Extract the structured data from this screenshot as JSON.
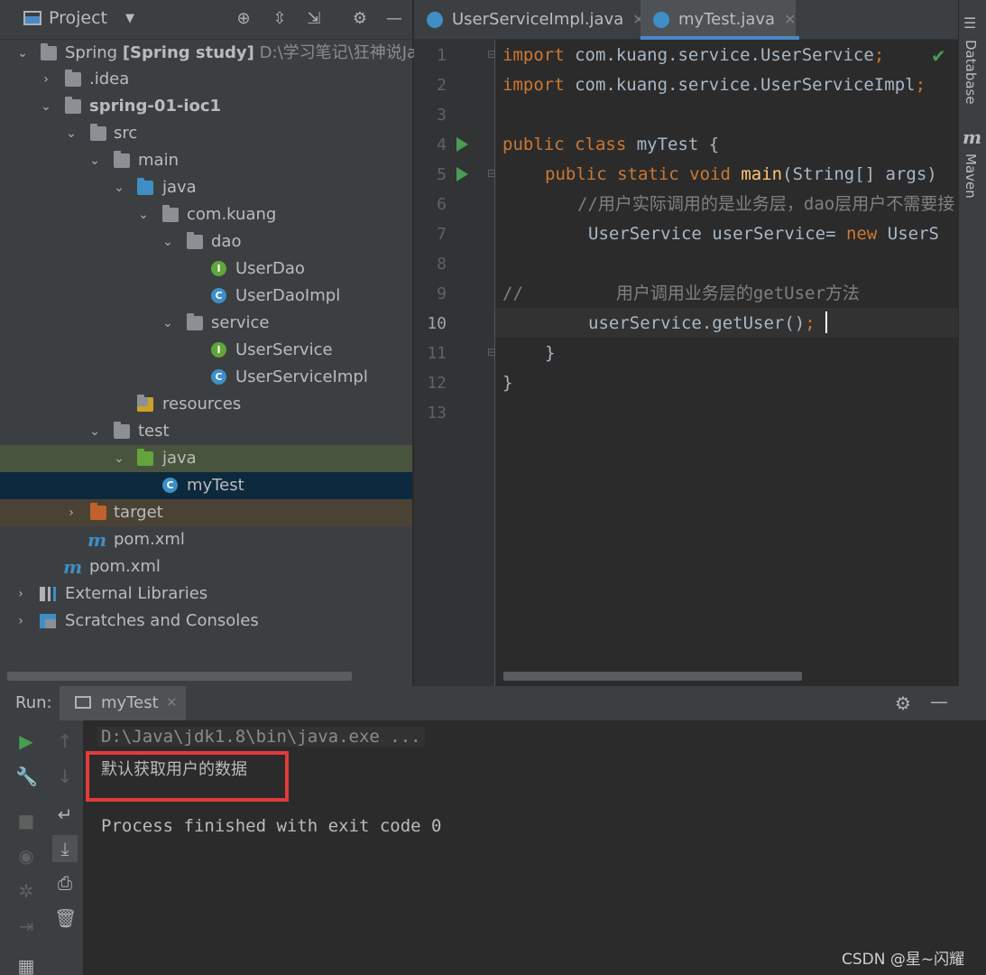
{
  "project": {
    "title": "Project",
    "tree": [
      {
        "label": "Spring",
        "bold_part": "[Spring study]",
        "path": "D:\\学习笔记\\狂神说Jav"
      },
      {
        "label": ".idea"
      },
      {
        "label": "spring-01-ioc1"
      },
      {
        "label": "src"
      },
      {
        "label": "main"
      },
      {
        "label": "java"
      },
      {
        "label": "com.kuang"
      },
      {
        "label": "dao"
      },
      {
        "label": "UserDao"
      },
      {
        "label": "UserDaoImpl"
      },
      {
        "label": "service"
      },
      {
        "label": "UserService"
      },
      {
        "label": "UserServiceImpl"
      },
      {
        "label": "resources"
      },
      {
        "label": "test"
      },
      {
        "label": "java"
      },
      {
        "label": "myTest"
      },
      {
        "label": "target"
      },
      {
        "label": "pom.xml"
      },
      {
        "label": "pom.xml"
      },
      {
        "label": "External Libraries"
      },
      {
        "label": "Scratches and Consoles"
      }
    ]
  },
  "editor": {
    "tabs": [
      {
        "label": "UserServiceImpl.java"
      },
      {
        "label": "myTest.java"
      }
    ],
    "line_numbers": [
      "1",
      "2",
      "3",
      "4",
      "5",
      "6",
      "7",
      "8",
      "9",
      "10",
      "11",
      "12",
      "13"
    ],
    "lines": {
      "l1_kw": "import",
      "l1_rest": " com.kuang.service.UserService",
      "l1_semi": ";",
      "l2_kw": "import",
      "l2_rest": " com.kuang.service.UserServiceImpl",
      "l2_semi": ";",
      "l4_kw": "public class",
      "l4_rest": " myTest {",
      "l5_kw": "public static void",
      "l5_fn": "main",
      "l5_rest": "(String[] args)",
      "l6": "//用户实际调用的是业务层，dao层用户不需要接",
      "l7_a": "UserService userService= ",
      "l7_kw": "new",
      "l7_b": " UserS",
      "l9": "//         用户调用业务层的getUser方法",
      "l10": "userService.getUser()",
      "l10_semi": ";",
      "l11": "}",
      "l12": "}"
    }
  },
  "right_strip": {
    "database": "Database",
    "maven_icon": "m",
    "maven": "Maven"
  },
  "run": {
    "label": "Run:",
    "tab": "myTest",
    "console": {
      "cmd": "D:\\Java\\jdk1.8\\bin\\java.exe ...",
      "output": "默认获取用户的数据",
      "exit": "Process finished with exit code 0"
    }
  },
  "watermark": "CSDN @星~闪耀"
}
